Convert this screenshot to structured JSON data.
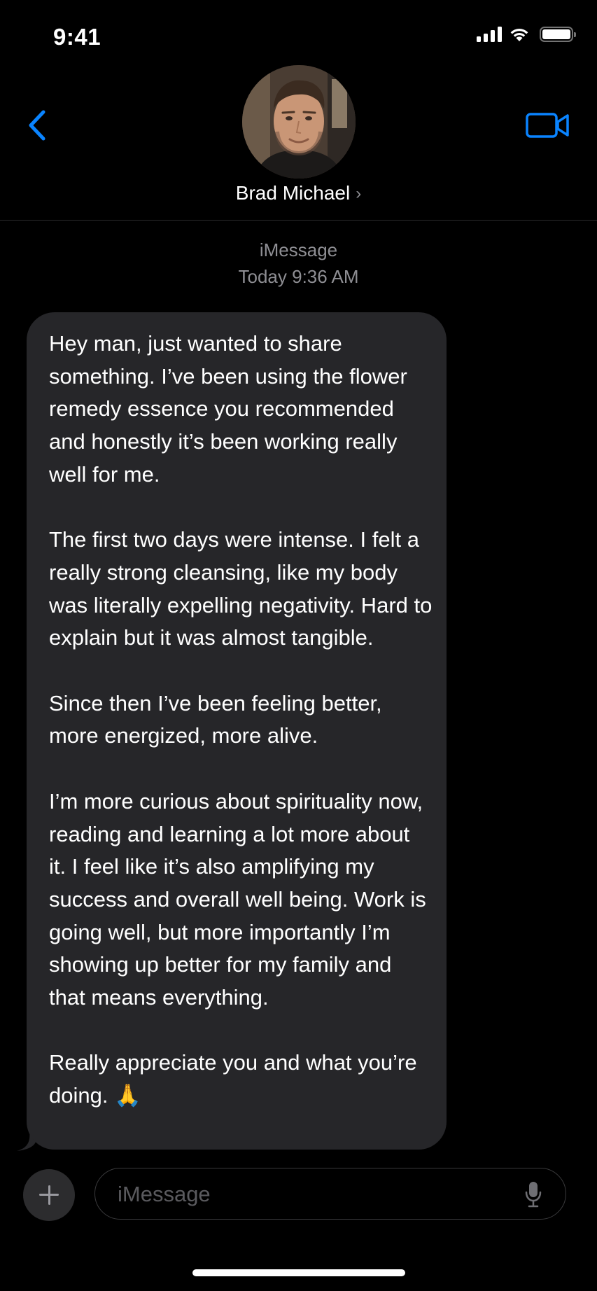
{
  "status_bar": {
    "time": "9:41"
  },
  "header": {
    "contact_name": "Brad Michael",
    "chevron": "›",
    "back_icon": "chevron-left-icon",
    "video_icon": "video-camera-icon"
  },
  "conversation": {
    "service": "iMessage",
    "timestamp": "Today 9:36 AM",
    "message": {
      "paragraphs": [
        "Hey man, just wanted to share something. I’ve been using the flower remedy essence you recommended and honestly it’s been working really well for me.",
        "The first two days were intense. I felt a really strong cleansing, like my body was literally expelling negativity. Hard to explain but it was almost tangible.",
        "Since then I’ve been feeling better, more energized, more alive.",
        "I’m more curious about spirituality now, reading and learning a lot more about it. I feel like it’s also amplifying my success and overall well being. Work is going well, but more importantly I’m showing up better for my family and that means everything.",
        "Really appreciate you and what you’re doing. 🙏"
      ]
    }
  },
  "input_bar": {
    "placeholder": "iMessage",
    "value": ""
  },
  "colors": {
    "background": "#000000",
    "bubble": "#262629",
    "accent": "#0a84ff",
    "secondary_text": "#8e8e93"
  }
}
